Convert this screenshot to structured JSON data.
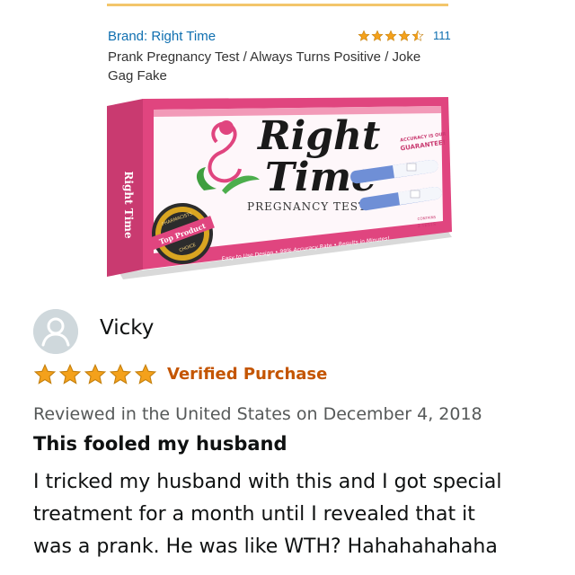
{
  "product": {
    "brand_label": "Brand: Right Time",
    "rating_count": "111",
    "rating_stars": 4.5,
    "title": "Prank Pregnancy Test / Always Turns Positive / Joke Gag Fake",
    "box": {
      "logo_line1": "Right",
      "logo_line2": "Time",
      "subtitle": "PREGNANCY TEST",
      "guarantee_line1": "ACCURACY IS OUR",
      "guarantee_line2": "GUARANTEE!",
      "tagline": "Easy to Use Design • 99% Accuracy Rate • Results in Minutes!",
      "badge_top": "PHARMACISTS",
      "badge_middle": "Top Product",
      "badge_bottom": "CHOICE",
      "count_line1": "CONTAINS",
      "count_line2": "2 TESTS",
      "side_text": "Right Time"
    }
  },
  "review": {
    "reviewer": "Vicky",
    "stars": 5,
    "verified_label": "Verified Purchase",
    "date": "Reviewed in the United States on December 4, 2018",
    "title": "This fooled my husband",
    "body_lines": [
      "I tricked my husband with this and I got special",
      "treatment for a month until I revealed that it",
      "was a prank. He was like WTH? Hahahahahaha"
    ]
  },
  "colors": {
    "link": "#0f6fb0",
    "star": "#f4a11b",
    "verified": "#c45500",
    "box_pink": "#e0457f",
    "box_blue": "#6f8fd6"
  }
}
